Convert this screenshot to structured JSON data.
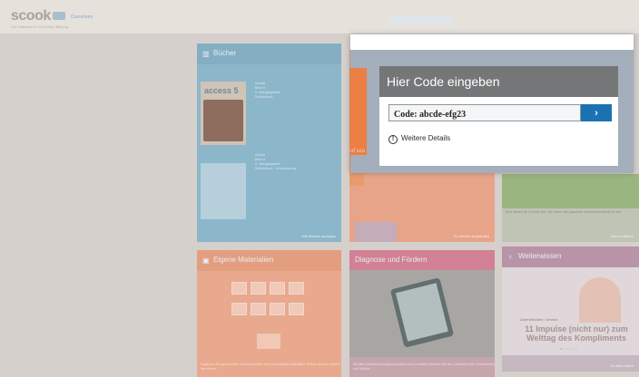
{
  "app": {
    "logo": "scook",
    "logo_sub": "Die Plattform für Cornelsen-Bildung",
    "cornelsen_badge": "Cornelsen"
  },
  "tiles": {
    "books": {
      "title": "Bücher",
      "cover_title": "access 5",
      "meta_1": "Access\nBand 5\n5. Jahrgangsstufe\nSchülerbuch",
      "meta_2": "Access\nBand 5\n5. Jahrgangsstufe\nSchülerbuch - Lehrerfassung",
      "footer": "Alle Bücher anzeigen"
    },
    "mid": {
      "peek_text": "uf sco",
      "footer": "Zu meinen Angeboten"
    },
    "right": {
      "caption": "Bald starten die Fußball WM. Wir haben das passende Unterrichtsmaterial für Sie!",
      "footer": "Mehr erfahren"
    },
    "own": {
      "title": "Eigene Materialien",
      "text": "Ergänzen Sie ganz einfach und übersichtlich Ihre persönlichen Materialien. Einfach auf das Symbol hier klicken"
    },
    "diag": {
      "title": "Diagnose und Fördern",
      "text": "Mit dem Schülertest-Angebot passend zum Lehrwerk erfassen Sie den Lernstand Ihrer Schülerinnen und Schüler"
    },
    "know": {
      "title": "Weiterwissen",
      "kicker": "Unterrichtsideen • Deutsch",
      "headline": "11 Impulse (nicht nur) zum Welttag des Kompliments",
      "dots": "●○○○○○",
      "footer": "Zu allen Ideen"
    }
  },
  "modal": {
    "title": "Hier Code eingeben",
    "code_value": "Code: abcde-efg23",
    "submit_icon": "chevron-right-icon",
    "details_label": "Weitere Details",
    "info_icon": "info-circle-icon"
  },
  "colors": {
    "header_gray": "#757677",
    "submit_blue": "#1b72b1",
    "accent_orange": "#ec7f44"
  }
}
